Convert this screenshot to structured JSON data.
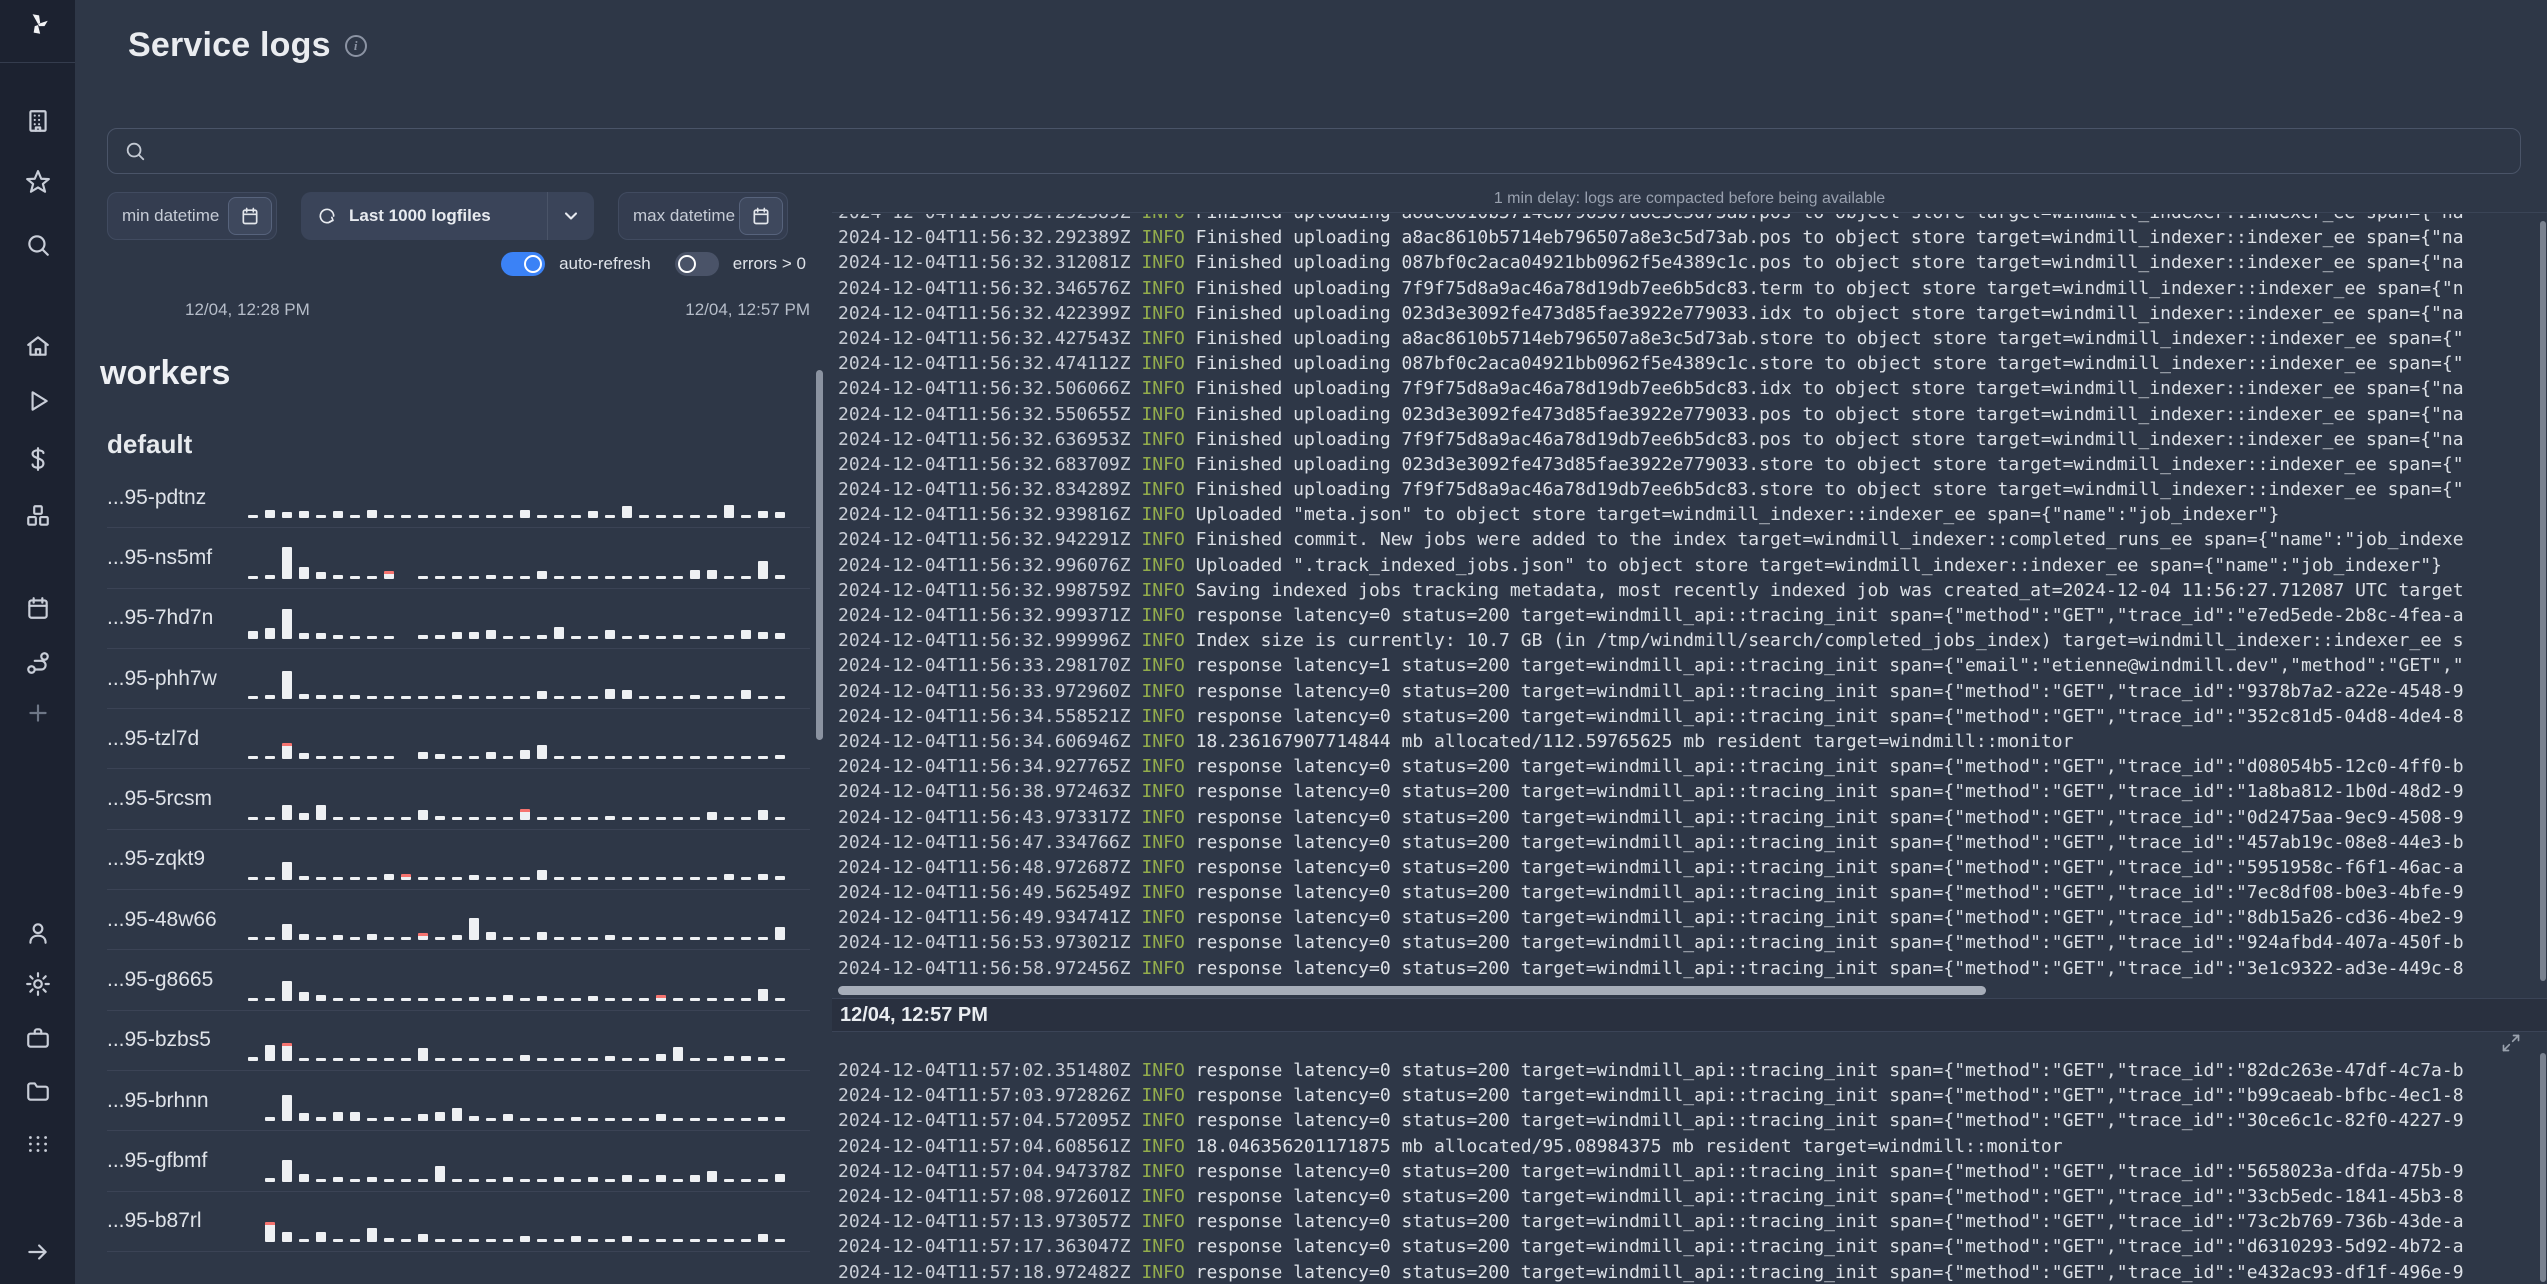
{
  "app": {
    "title": "Service logs"
  },
  "colors": {
    "accent": "#3b82f6",
    "info_level": "#93ad4c",
    "bar": "#eef0f3",
    "error": "#f5736f"
  },
  "search": {
    "value": "",
    "placeholder": ""
  },
  "filters": {
    "min_datetime_label": "min datetime",
    "logfiles_label": "Last 1000 logfiles",
    "max_datetime_label": "max datetime",
    "auto_refresh_label": "auto-refresh",
    "errors_label": "errors > 0",
    "auto_refresh_on": true,
    "errors_on": false
  },
  "time_range": {
    "start": "12/04, 12:28 PM",
    "end": "12/04, 12:57 PM"
  },
  "sidebar": {
    "icons": [
      "windmill-logo",
      "building",
      "star",
      "search",
      "home",
      "play",
      "dollar",
      "boxes",
      "calendar",
      "route",
      "plus",
      "user",
      "gear",
      "briefcase",
      "folder",
      "grid-dots",
      "arrow-right"
    ]
  },
  "workers": {
    "heading": "workers",
    "group": "default",
    "items": [
      {
        "name": "...95-pdtnz",
        "bars": [
          3,
          8,
          6,
          7,
          3,
          7,
          3,
          8,
          3,
          3,
          3,
          3,
          3,
          3,
          3,
          3,
          8,
          3,
          3,
          3,
          7,
          3,
          12,
          3,
          3,
          3,
          3,
          3,
          13,
          3,
          7,
          6
        ],
        "errors": []
      },
      {
        "name": "...95-ns5mf",
        "bars": [
          3,
          4,
          32,
          12,
          7,
          4,
          3,
          3,
          8,
          0,
          3,
          3,
          3,
          3,
          4,
          3,
          3,
          8,
          3,
          3,
          3,
          3,
          3,
          3,
          3,
          3,
          9,
          9,
          3,
          3,
          18,
          4
        ],
        "errors": [
          8
        ]
      },
      {
        "name": "...95-7hd7n",
        "bars": [
          8,
          11,
          30,
          6,
          6,
          4,
          3,
          3,
          3,
          0,
          4,
          4,
          7,
          7,
          9,
          3,
          3,
          4,
          12,
          3,
          3,
          9,
          3,
          4,
          3,
          4,
          3,
          3,
          4,
          9,
          7,
          6
        ],
        "errors": []
      },
      {
        "name": "...95-phh7w",
        "bars": [
          3,
          4,
          28,
          5,
          4,
          4,
          4,
          3,
          3,
          3,
          3,
          3,
          4,
          3,
          3,
          3,
          3,
          8,
          3,
          3,
          3,
          10,
          9,
          3,
          3,
          3,
          4,
          3,
          3,
          9,
          3,
          3
        ],
        "errors": []
      },
      {
        "name": "...95-tzl7d",
        "bars": [
          3,
          3,
          16,
          6,
          3,
          3,
          3,
          3,
          3,
          0,
          7,
          5,
          3,
          3,
          7,
          3,
          9,
          14,
          3,
          3,
          3,
          3,
          3,
          3,
          3,
          3,
          3,
          3,
          3,
          3,
          3,
          4
        ],
        "errors": [
          2
        ]
      },
      {
        "name": "...95-5rcsm",
        "bars": [
          3,
          3,
          15,
          7,
          15,
          3,
          3,
          3,
          3,
          3,
          10,
          4,
          3,
          3,
          3,
          3,
          11,
          3,
          3,
          3,
          3,
          4,
          3,
          3,
          3,
          3,
          3,
          8,
          3,
          3,
          10,
          3
        ],
        "errors": [
          16
        ]
      },
      {
        "name": "...95-zqkt9",
        "bars": [
          3,
          3,
          18,
          4,
          3,
          3,
          3,
          3,
          6,
          6,
          3,
          3,
          3,
          5,
          3,
          3,
          3,
          10,
          3,
          3,
          3,
          3,
          3,
          3,
          3,
          3,
          3,
          3,
          6,
          3,
          6,
          4
        ],
        "errors": [
          9
        ]
      },
      {
        "name": "...95-48w66",
        "bars": [
          3,
          3,
          16,
          6,
          3,
          5,
          3,
          6,
          3,
          3,
          7,
          3,
          5,
          22,
          8,
          3,
          3,
          8,
          3,
          3,
          3,
          5,
          3,
          3,
          3,
          3,
          3,
          3,
          3,
          3,
          3,
          13
        ],
        "errors": [
          10
        ]
      },
      {
        "name": "...95-g8665",
        "bars": [
          3,
          3,
          20,
          9,
          6,
          3,
          3,
          3,
          3,
          3,
          3,
          3,
          3,
          4,
          4,
          6,
          3,
          5,
          3,
          3,
          5,
          3,
          3,
          3,
          6,
          3,
          3,
          3,
          3,
          3,
          12,
          3
        ],
        "errors": [
          24
        ]
      },
      {
        "name": "...95-bzbs5",
        "bars": [
          4,
          16,
          18,
          3,
          3,
          3,
          3,
          3,
          3,
          3,
          13,
          3,
          3,
          3,
          3,
          3,
          6,
          3,
          3,
          3,
          3,
          5,
          3,
          3,
          7,
          14,
          3,
          3,
          5,
          5,
          4,
          3
        ],
        "errors": [
          2
        ]
      },
      {
        "name": "...95-brhnn",
        "bars": [
          0,
          4,
          26,
          8,
          4,
          9,
          9,
          3,
          4,
          3,
          7,
          9,
          13,
          5,
          3,
          7,
          3,
          3,
          3,
          4,
          3,
          3,
          3,
          3,
          7,
          3,
          3,
          3,
          3,
          3,
          4,
          4
        ],
        "errors": []
      },
      {
        "name": "...95-gfbmf",
        "bars": [
          0,
          4,
          22,
          8,
          3,
          5,
          3,
          5,
          3,
          3,
          3,
          16,
          3,
          3,
          3,
          5,
          3,
          3,
          5,
          3,
          5,
          3,
          7,
          3,
          7,
          3,
          7,
          11,
          3,
          3,
          3,
          8
        ],
        "errors": []
      },
      {
        "name": "...95-b87rl",
        "bars": [
          0,
          20,
          10,
          3,
          10,
          3,
          3,
          14,
          4,
          3,
          8,
          3,
          3,
          3,
          3,
          3,
          6,
          3,
          3,
          6,
          3,
          3,
          6,
          3,
          3,
          3,
          3,
          3,
          3,
          3,
          8,
          3
        ],
        "errors": [
          1
        ]
      }
    ]
  },
  "logs": {
    "notice": "1 min delay: logs are compacted before being available",
    "section2_header": "12/04, 12:57 PM",
    "top_lines": [
      {
        "t": "2024-12-04T11:56:32.292389Z",
        "l": "INFO",
        "m": "Finished uploading a8ac8610b5714eb796507a8e3c5d73ab.pos to object store target=windmill_indexer::indexer_ee span={\"na"
      },
      {
        "t": "2024-12-04T11:56:32.312081Z",
        "l": "INFO",
        "m": "Finished uploading 087bf0c2aca04921bb0962f5e4389c1c.pos to object store target=windmill_indexer::indexer_ee span={\"na"
      },
      {
        "t": "2024-12-04T11:56:32.346576Z",
        "l": "INFO",
        "m": "Finished uploading 7f9f75d8a9ac46a78d19db7ee6b5dc83.term to object store target=windmill_indexer::indexer_ee span={\"n"
      },
      {
        "t": "2024-12-04T11:56:32.422399Z",
        "l": "INFO",
        "m": "Finished uploading 023d3e3092fe473d85fae3922e779033.idx to object store target=windmill_indexer::indexer_ee span={\"na"
      },
      {
        "t": "2024-12-04T11:56:32.427543Z",
        "l": "INFO",
        "m": "Finished uploading a8ac8610b5714eb796507a8e3c5d73ab.store to object store target=windmill_indexer::indexer_ee span={\""
      },
      {
        "t": "2024-12-04T11:56:32.474112Z",
        "l": "INFO",
        "m": "Finished uploading 087bf0c2aca04921bb0962f5e4389c1c.store to object store target=windmill_indexer::indexer_ee span={\""
      },
      {
        "t": "2024-12-04T11:56:32.506066Z",
        "l": "INFO",
        "m": "Finished uploading 7f9f75d8a9ac46a78d19db7ee6b5dc83.idx to object store target=windmill_indexer::indexer_ee span={\"na"
      },
      {
        "t": "2024-12-04T11:56:32.550655Z",
        "l": "INFO",
        "m": "Finished uploading 023d3e3092fe473d85fae3922e779033.pos to object store target=windmill_indexer::indexer_ee span={\"na"
      },
      {
        "t": "2024-12-04T11:56:32.636953Z",
        "l": "INFO",
        "m": "Finished uploading 7f9f75d8a9ac46a78d19db7ee6b5dc83.pos to object store target=windmill_indexer::indexer_ee span={\"na"
      },
      {
        "t": "2024-12-04T11:56:32.683709Z",
        "l": "INFO",
        "m": "Finished uploading 023d3e3092fe473d85fae3922e779033.store to object store target=windmill_indexer::indexer_ee span={\""
      },
      {
        "t": "2024-12-04T11:56:32.834289Z",
        "l": "INFO",
        "m": "Finished uploading 7f9f75d8a9ac46a78d19db7ee6b5dc83.store to object store target=windmill_indexer::indexer_ee span={\""
      },
      {
        "t": "2024-12-04T11:56:32.939816Z",
        "l": "INFO",
        "m": "Uploaded \"meta.json\" to object store target=windmill_indexer::indexer_ee span={\"name\":\"job_indexer\"}"
      },
      {
        "t": "2024-12-04T11:56:32.942291Z",
        "l": "INFO",
        "m": "Finished commit. New jobs were added to the index target=windmill_indexer::completed_runs_ee span={\"name\":\"job_indexe"
      },
      {
        "t": "2024-12-04T11:56:32.996076Z",
        "l": "INFO",
        "m": "Uploaded \".track_indexed_jobs.json\" to object store target=windmill_indexer::indexer_ee span={\"name\":\"job_indexer\"}"
      },
      {
        "t": "2024-12-04T11:56:32.998759Z",
        "l": "INFO",
        "m": "Saving indexed jobs tracking metadata, most recently indexed job was created_at=2024-12-04 11:56:27.712087 UTC target"
      },
      {
        "t": "2024-12-04T11:56:32.999371Z",
        "l": "INFO",
        "m": "response latency=0 status=200 target=windmill_api::tracing_init span={\"method\":\"GET\",\"trace_id\":\"e7ed5ede-2b8c-4fea-a"
      },
      {
        "t": "2024-12-04T11:56:32.999996Z",
        "l": "INFO",
        "m": "Index size is currently: 10.7 GB (in /tmp/windmill/search/completed_jobs_index) target=windmill_indexer::indexer_ee s"
      },
      {
        "t": "2024-12-04T11:56:33.298170Z",
        "l": "INFO",
        "m": "response latency=1 status=200 target=windmill_api::tracing_init span={\"email\":\"etienne@windmill.dev\",\"method\":\"GET\",\""
      },
      {
        "t": "2024-12-04T11:56:33.972960Z",
        "l": "INFO",
        "m": "response latency=0 status=200 target=windmill_api::tracing_init span={\"method\":\"GET\",\"trace_id\":\"9378b7a2-a22e-4548-9"
      },
      {
        "t": "2024-12-04T11:56:34.558521Z",
        "l": "INFO",
        "m": "response latency=0 status=200 target=windmill_api::tracing_init span={\"method\":\"GET\",\"trace_id\":\"352c81d5-04d8-4de4-8"
      },
      {
        "t": "2024-12-04T11:56:34.606946Z",
        "l": "INFO",
        "m": "18.236167907714844 mb allocated/112.59765625 mb resident target=windmill::monitor"
      },
      {
        "t": "2024-12-04T11:56:34.927765Z",
        "l": "INFO",
        "m": "response latency=0 status=200 target=windmill_api::tracing_init span={\"method\":\"GET\",\"trace_id\":\"d08054b5-12c0-4ff0-b"
      },
      {
        "t": "2024-12-04T11:56:38.972463Z",
        "l": "INFO",
        "m": "response latency=0 status=200 target=windmill_api::tracing_init span={\"method\":\"GET\",\"trace_id\":\"1a8ba812-1b0d-48d2-9"
      },
      {
        "t": "2024-12-04T11:56:43.973317Z",
        "l": "INFO",
        "m": "response latency=0 status=200 target=windmill_api::tracing_init span={\"method\":\"GET\",\"trace_id\":\"0d2475aa-9ec9-4508-9"
      },
      {
        "t": "2024-12-04T11:56:47.334766Z",
        "l": "INFO",
        "m": "response latency=0 status=200 target=windmill_api::tracing_init span={\"method\":\"GET\",\"trace_id\":\"457ab19c-08e8-44e3-b"
      },
      {
        "t": "2024-12-04T11:56:48.972687Z",
        "l": "INFO",
        "m": "response latency=0 status=200 target=windmill_api::tracing_init span={\"method\":\"GET\",\"trace_id\":\"5951958c-f6f1-46ac-a"
      },
      {
        "t": "2024-12-04T11:56:49.562549Z",
        "l": "INFO",
        "m": "response latency=0 status=200 target=windmill_api::tracing_init span={\"method\":\"GET\",\"trace_id\":\"7ec8df08-b0e3-4bfe-9"
      },
      {
        "t": "2024-12-04T11:56:49.934741Z",
        "l": "INFO",
        "m": "response latency=0 status=200 target=windmill_api::tracing_init span={\"method\":\"GET\",\"trace_id\":\"8db15a26-cd36-4be2-9"
      },
      {
        "t": "2024-12-04T11:56:53.973021Z",
        "l": "INFO",
        "m": "response latency=0 status=200 target=windmill_api::tracing_init span={\"method\":\"GET\",\"trace_id\":\"924afbd4-407a-450f-b"
      },
      {
        "t": "2024-12-04T11:56:58.972456Z",
        "l": "INFO",
        "m": "response latency=0 status=200 target=windmill_api::tracing_init span={\"method\":\"GET\",\"trace_id\":\"3e1c9322-ad3e-449c-8"
      }
    ],
    "bottom_lines": [
      {
        "t": "2024-12-04T11:57:02.351480Z",
        "l": "INFO",
        "m": "response latency=0 status=200 target=windmill_api::tracing_init span={\"method\":\"GET\",\"trace_id\":\"82dc263e-47df-4c7a-b"
      },
      {
        "t": "2024-12-04T11:57:03.972826Z",
        "l": "INFO",
        "m": "response latency=0 status=200 target=windmill_api::tracing_init span={\"method\":\"GET\",\"trace_id\":\"b99caeab-bfbc-4ec1-8"
      },
      {
        "t": "2024-12-04T11:57:04.572095Z",
        "l": "INFO",
        "m": "response latency=0 status=200 target=windmill_api::tracing_init span={\"method\":\"GET\",\"trace_id\":\"30ce6c1c-82f0-4227-9"
      },
      {
        "t": "2024-12-04T11:57:04.608561Z",
        "l": "INFO",
        "m": "18.046356201171875 mb allocated/95.08984375 mb resident target=windmill::monitor"
      },
      {
        "t": "2024-12-04T11:57:04.947378Z",
        "l": "INFO",
        "m": "response latency=0 status=200 target=windmill_api::tracing_init span={\"method\":\"GET\",\"trace_id\":\"5658023a-dfda-475b-9"
      },
      {
        "t": "2024-12-04T11:57:08.972601Z",
        "l": "INFO",
        "m": "response latency=0 status=200 target=windmill_api::tracing_init span={\"method\":\"GET\",\"trace_id\":\"33cb5edc-1841-45b3-8"
      },
      {
        "t": "2024-12-04T11:57:13.973057Z",
        "l": "INFO",
        "m": "response latency=0 status=200 target=windmill_api::tracing_init span={\"method\":\"GET\",\"trace_id\":\"73c2b769-736b-43de-a"
      },
      {
        "t": "2024-12-04T11:57:17.363047Z",
        "l": "INFO",
        "m": "response latency=0 status=200 target=windmill_api::tracing_init span={\"method\":\"GET\",\"trace_id\":\"d6310293-5d92-4b72-a"
      },
      {
        "t": "2024-12-04T11:57:18.972482Z",
        "l": "INFO",
        "m": "response latency=0 status=200 target=windmill_api::tracing_init span={\"method\":\"GET\",\"trace_id\":\"e432ac93-df1f-496e-9"
      }
    ]
  }
}
